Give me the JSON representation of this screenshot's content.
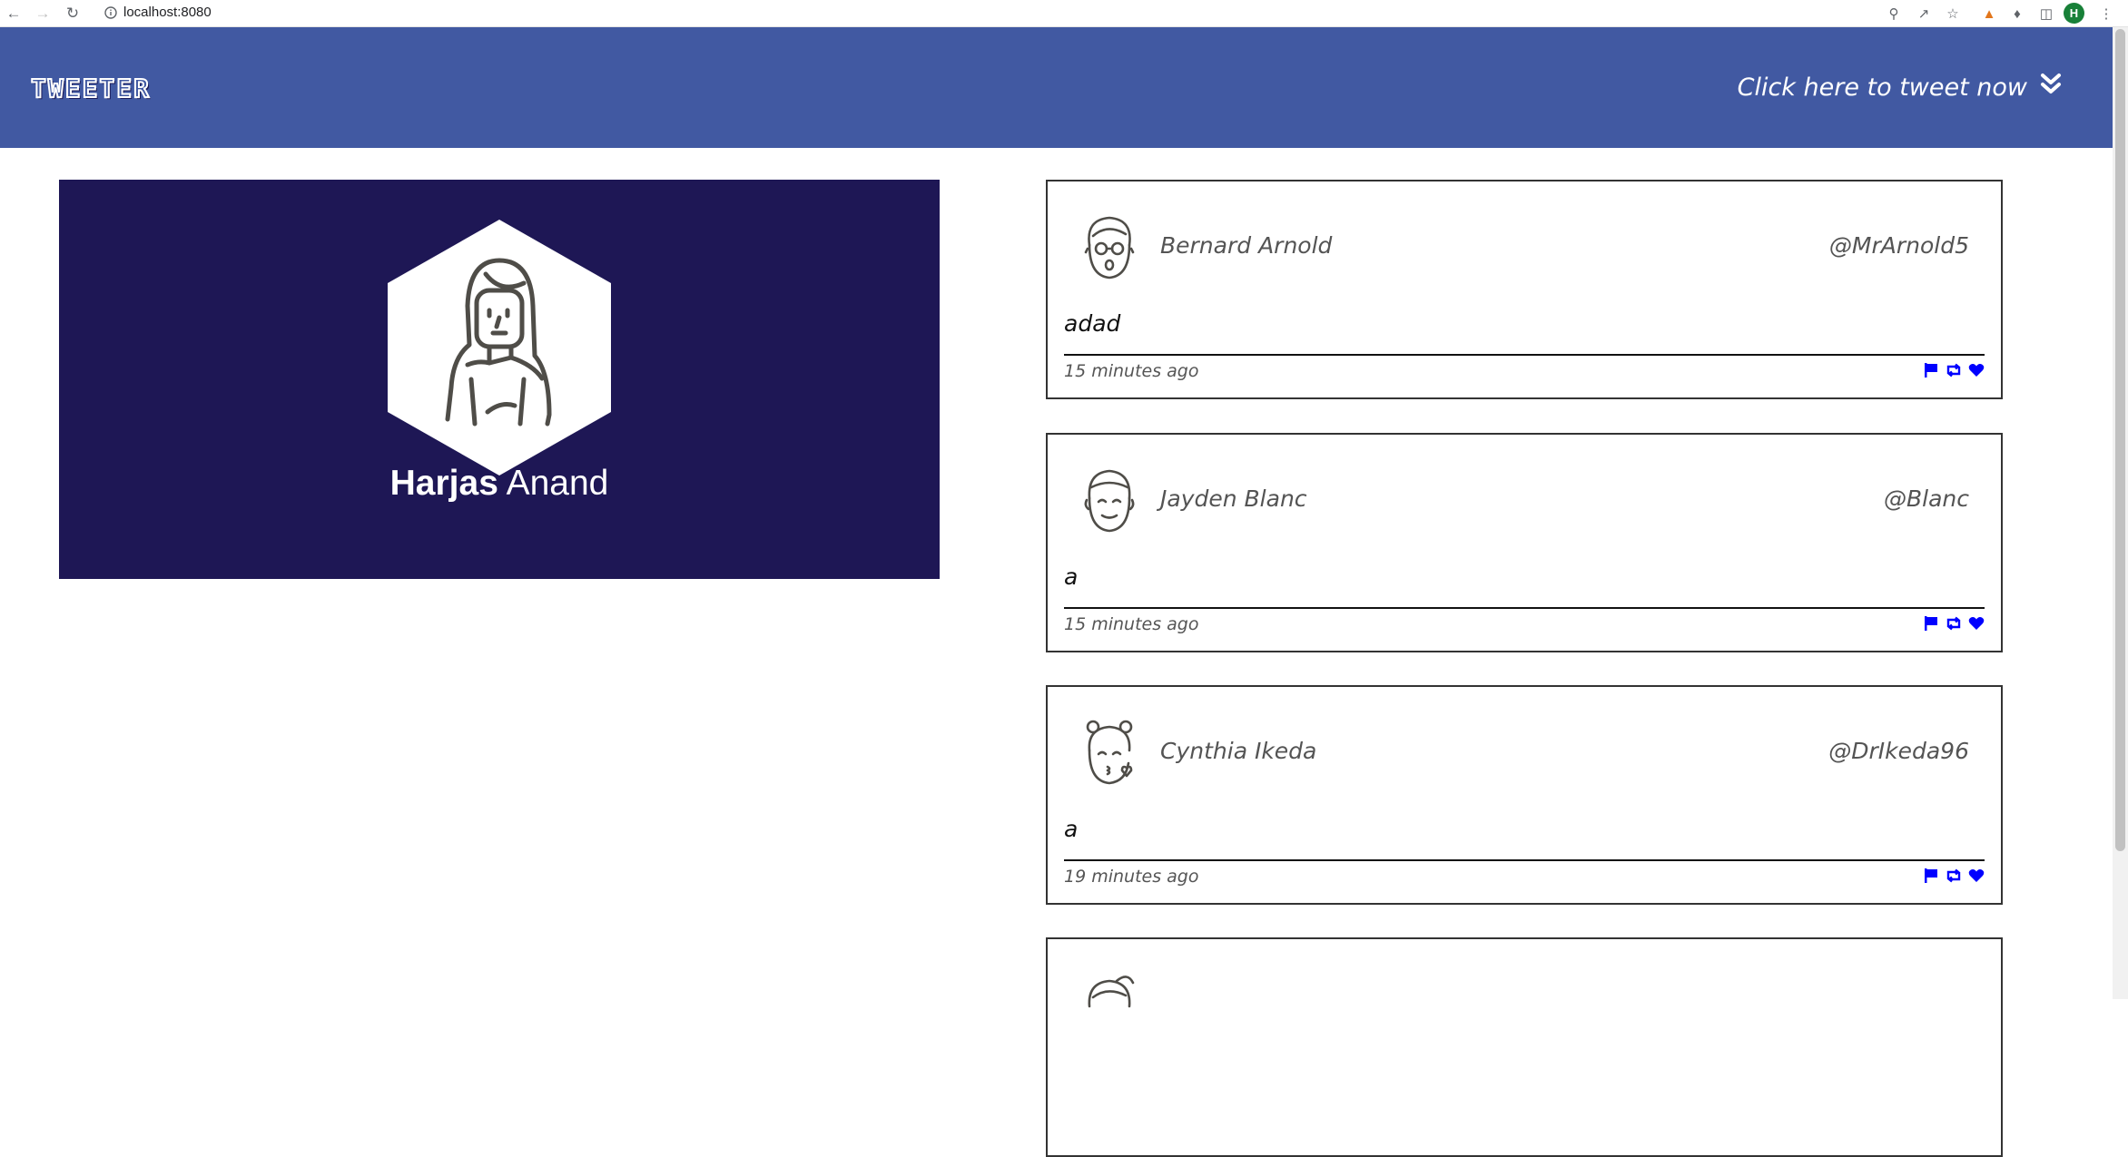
{
  "browser": {
    "url": "localhost:8080",
    "profile_initial": "H"
  },
  "header": {
    "logo": "TWEETER",
    "compose_label": "Click here to tweet now"
  },
  "profile": {
    "first_name": "Harjas",
    "last_name": "Anand"
  },
  "tweets": [
    {
      "name": "Bernard Arnold",
      "handle": "@MrArnold5",
      "content": "adad",
      "time": "15 minutes ago",
      "avatar": "glasses-face-icon"
    },
    {
      "name": "Jayden Blanc",
      "handle": "@Blanc",
      "content": "a",
      "time": "15 minutes ago",
      "avatar": "smiling-face-icon"
    },
    {
      "name": "Cynthia Ikeda",
      "handle": "@DrIkeda96",
      "content": "a",
      "time": "19 minutes ago",
      "avatar": "kissing-face-icon"
    },
    {
      "name": "",
      "handle": "",
      "content": "",
      "time": "",
      "avatar": "ponytail-face-icon"
    }
  ],
  "colors": {
    "header_bg": "#4159a2",
    "profile_bg": "#1e1755",
    "action_icon": "#0000ff"
  }
}
